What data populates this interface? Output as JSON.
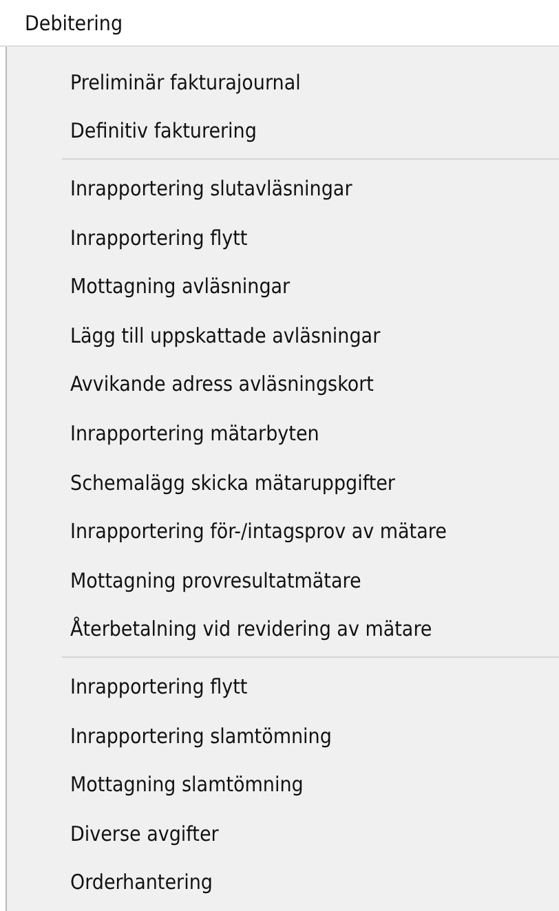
{
  "menu_bar": {
    "title": "Debitering"
  },
  "menu": {
    "groups": [
      {
        "items": [
          "Preliminär fakturajournal",
          "Definitiv fakturering"
        ]
      },
      {
        "items": [
          "Inrapportering slutavläsningar",
          "Inrapportering flytt",
          "Mottagning avläsningar",
          "Lägg till uppskattade avläsningar",
          "Avvikande adress avläsningskort",
          "Inrapportering mätarbyten",
          "Schemalägg skicka mätaruppgifter",
          "Inrapportering för-/intagsprov av mätare",
          "Mottagning provresultatmätare",
          "Återbetalning vid revidering av mätare"
        ]
      },
      {
        "items": [
          "Inrapportering flytt",
          "Inrapportering slamtömning",
          "Mottagning slamtömning",
          "Diverse avgifter",
          "Orderhantering"
        ]
      }
    ]
  }
}
